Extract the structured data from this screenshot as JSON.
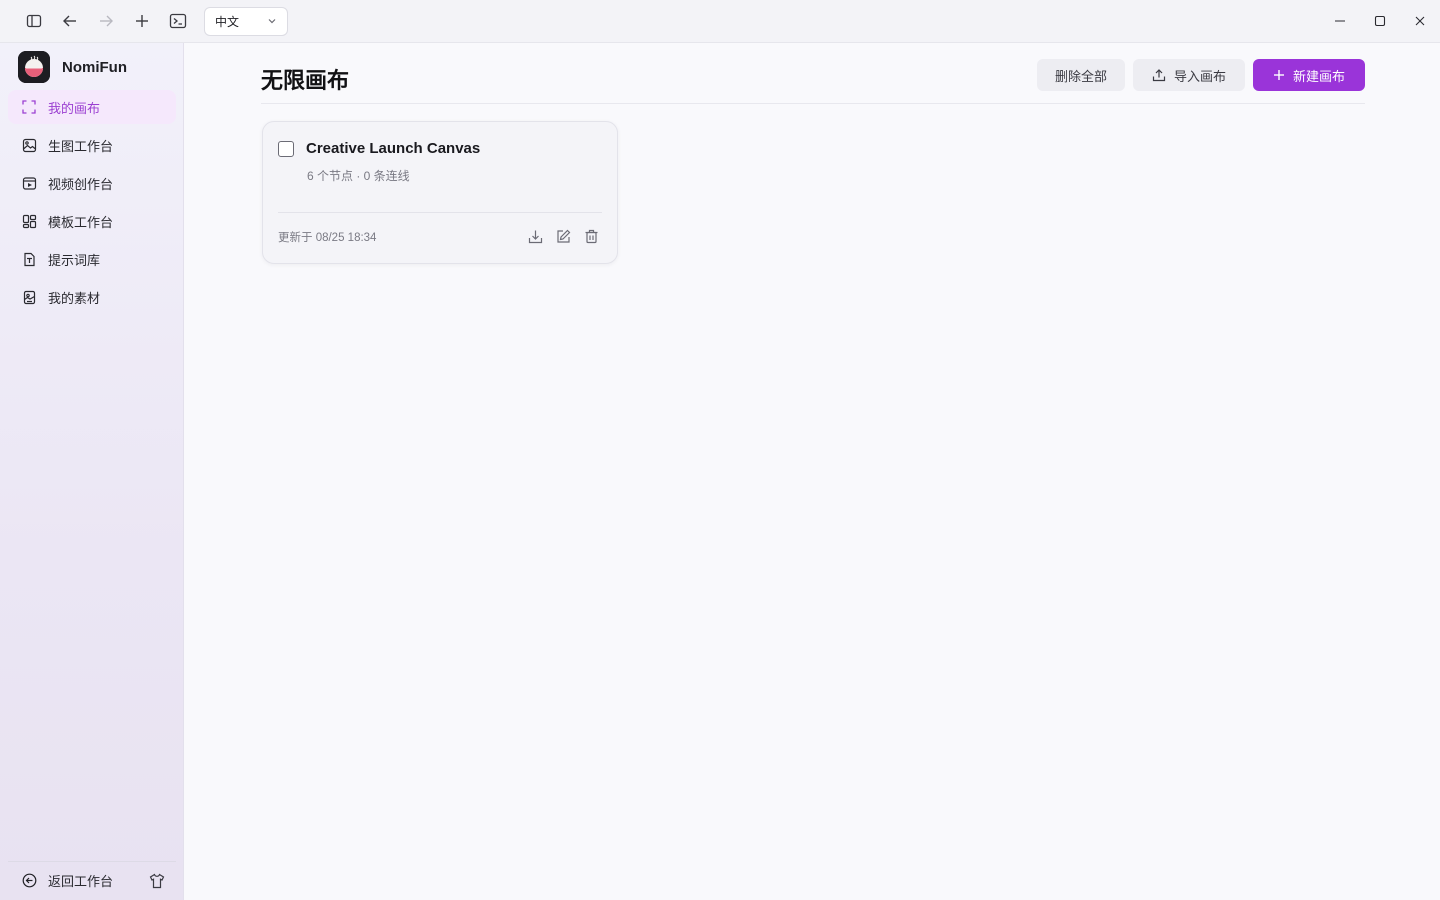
{
  "titlebar": {
    "language": "中文"
  },
  "brand": {
    "name": "NomiFun"
  },
  "sidebar": {
    "items": [
      {
        "label": "我的画布",
        "icon": "canvas-frame-icon"
      },
      {
        "label": "生图工作台",
        "icon": "image-gen-icon"
      },
      {
        "label": "视频创作台",
        "icon": "video-icon"
      },
      {
        "label": "模板工作台",
        "icon": "template-icon"
      },
      {
        "label": "提示词库",
        "icon": "prompt-text-icon"
      },
      {
        "label": "我的素材",
        "icon": "asset-icon"
      }
    ],
    "footer_label": "返回工作台"
  },
  "main": {
    "title": "无限画布",
    "delete_all": "删除全部",
    "import": "导入画布",
    "new": "新建画布"
  },
  "card": {
    "title": "Creative Launch Canvas",
    "subtitle": "6 个节点 · 0 条连线",
    "updated": "更新于 08/25 18:34"
  },
  "colors": {
    "accent": "#9a34d9",
    "active_bg": "#f5e8fc",
    "active_text": "#9b3fd1"
  }
}
